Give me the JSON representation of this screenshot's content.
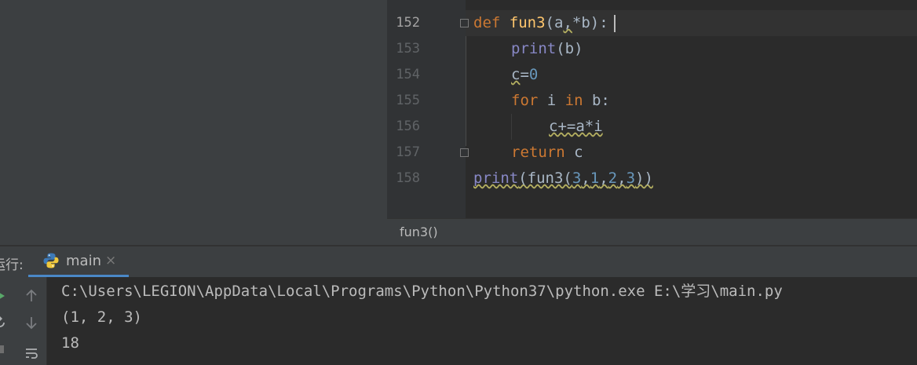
{
  "editor": {
    "line_numbers": [
      "152",
      "153",
      "154",
      "155",
      "156",
      "157",
      "158"
    ],
    "code": {
      "l152": {
        "kw": "def",
        "fn": "fun3",
        "p1": "(a",
        "comma": ",",
        "p2": "*b):"
      },
      "l153": {
        "bi": "print",
        "rest": "(b)"
      },
      "l154": {
        "var": "c",
        "eq": "=",
        "num": "0"
      },
      "l155": {
        "kw_for": "for",
        "mid": " i ",
        "kw_in": "in",
        "rest": " b:"
      },
      "l156": {
        "text": "c+=a*i"
      },
      "l157": {
        "kw": "return",
        "rest": " c"
      },
      "l158": {
        "bi": "print",
        "p1": "(fun3(",
        "n1": "3",
        "c1": ",",
        "n2": "1",
        "c2": ",",
        "n3": "2",
        "c3": ",",
        "n4": "3",
        "p2": "))"
      }
    },
    "breadcrumb": "fun3()"
  },
  "run": {
    "label": "运行:",
    "tab_label": "main",
    "close_glyph": "×",
    "console_lines": [
      "C:\\Users\\LEGION\\AppData\\Local\\Programs\\Python\\Python37\\python.exe E:\\学习\\main.py",
      "(1, 2, 3)",
      "18"
    ]
  },
  "colors": {
    "keyword": "#cc7832",
    "function": "#ffc66d",
    "builtin": "#8888c6",
    "number": "#6897bb",
    "text": "#a9b7c6",
    "tab_accent": "#4a88c7"
  },
  "icons": [
    "python-icon",
    "run-icon",
    "rerun-icon",
    "scroll-up-icon",
    "scroll-down-icon",
    "soft-wrap-icon",
    "close-icon",
    "fold-icon"
  ]
}
